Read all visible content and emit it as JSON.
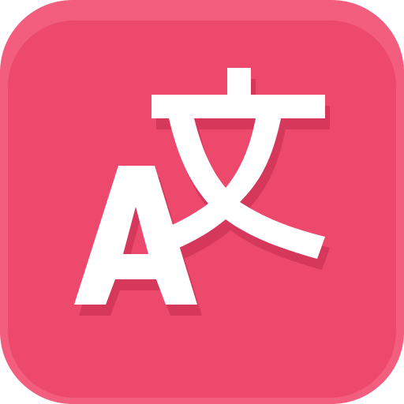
{
  "app_icon": {
    "glyph_latin": "A",
    "glyph_cjk": "文",
    "icon_name": "translate-icon",
    "colors": {
      "base": "#ef4b6e",
      "edge_highlight": "#f35e7f",
      "face": "#ec496d",
      "glyph": "#ffffff",
      "glyph_shadow": "#d6385b"
    }
  }
}
